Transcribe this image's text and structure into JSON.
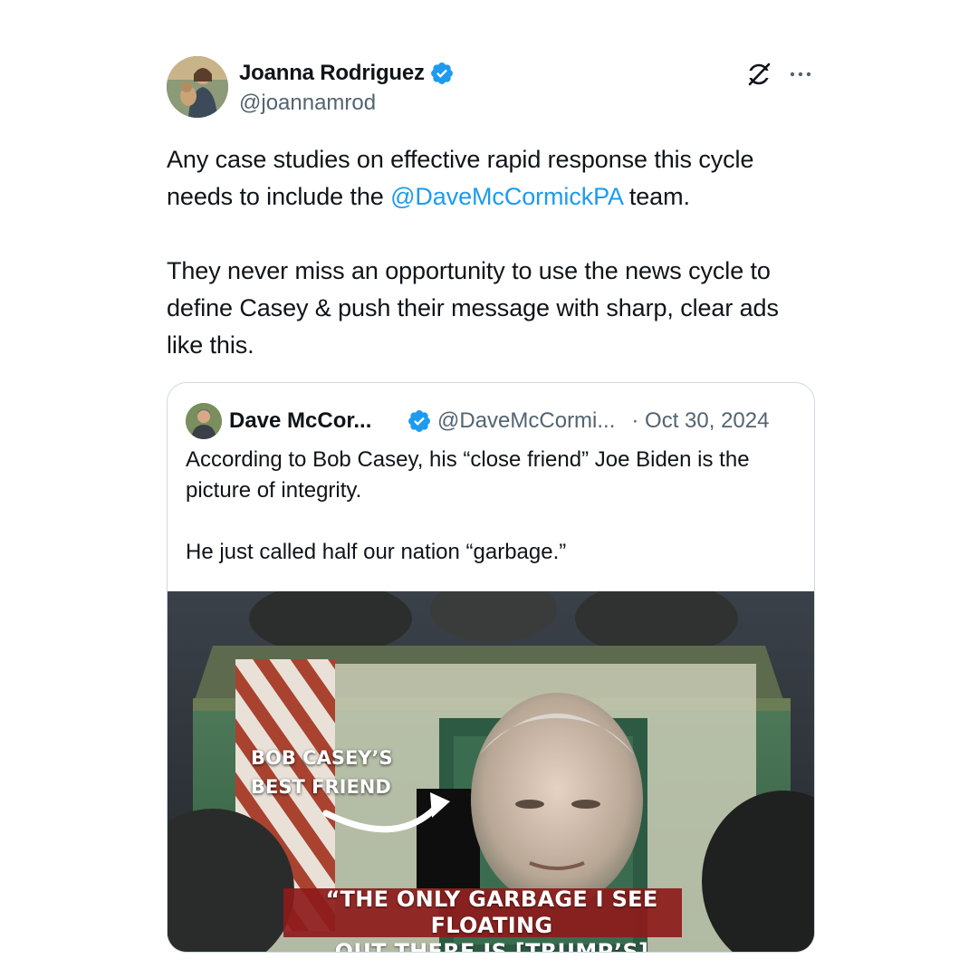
{
  "tweet": {
    "author": {
      "display_name": "Joanna Rodriguez",
      "handle": "@joannamrod",
      "verified": true
    },
    "icons": {
      "grok": "grok-icon",
      "more": "more-icon",
      "verified": "verified-badge-icon"
    },
    "text": {
      "line1_start": "Any case studies on effective rapid response this cycle needs to include the ",
      "mention": "@DaveMcCormickPA",
      "line1_end": " team.",
      "para2": "They never miss an opportunity to use the news cycle to define Casey & push their message with sharp, clear ads like this."
    },
    "quoted": {
      "display_name": "Dave McCor...",
      "handle": "@DaveMcCormi...",
      "date": "· Oct 30, 2024",
      "text_para1": "According to Bob Casey, his “close friend” Joe Biden is the picture of integrity.",
      "text_para2": "He just called half our nation “garbage.”",
      "media": {
        "overlay_label_line1": "BOB CASEY’S",
        "overlay_label_line2": "BEST FRIEND",
        "caption_line1": "“THE ONLY GARBAGE I SEE FLOATING",
        "caption_line2": "OUT THERE IS [TRUMP’S] SUPPORTERS”"
      }
    },
    "colors": {
      "link": "#1d9bf0",
      "verified": "#1d9bf0",
      "secondary_text": "#536471",
      "border": "#cfd9de",
      "caption_bg": "#8d1b1b"
    }
  }
}
